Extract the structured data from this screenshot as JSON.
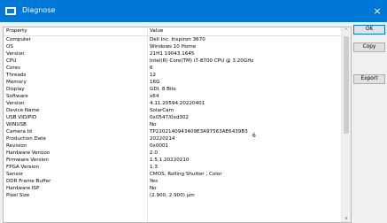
{
  "window": {
    "title": "Diagnose",
    "close_glyph": "×"
  },
  "table": {
    "columns": {
      "property": "Property",
      "value": "Value"
    },
    "rows": [
      {
        "property": "Computer",
        "value": "Dell Inc. Inspiron 3670"
      },
      {
        "property": "OS",
        "value": "Windows 10 Home"
      },
      {
        "property": "Version",
        "value": "21H1 19043.1645"
      },
      {
        "property": "CPU",
        "value": "Intel(R) Core(TM) i7-8700 CPU @ 3.20GHz"
      },
      {
        "property": "Cores",
        "value": "6"
      },
      {
        "property": "Threads",
        "value": "12"
      },
      {
        "property": "Memory",
        "value": "16G"
      },
      {
        "property": "Display",
        "value": "GDI, 8 Bits"
      },
      {
        "property": "Software",
        "value": "x64"
      },
      {
        "property": "Version",
        "value": "4.11.20594.20220401"
      },
      {
        "property": "Device Name",
        "value": "SolarCam"
      },
      {
        "property": "USB VID/PID",
        "value": "0x0547/0xd302"
      },
      {
        "property": "WINUSB",
        "value": "No"
      },
      {
        "property": "Camera Id",
        "value": "TP2202140943409E3A97563AE6439B3"
      },
      {
        "property": "Production Date",
        "value": "20220214"
      },
      {
        "property": "Revision",
        "value": "0x0001"
      },
      {
        "property": "Hardware Version",
        "value": "2.0"
      },
      {
        "property": "Firmware Version",
        "value": "1.5.1.20220210"
      },
      {
        "property": "FPGA Version",
        "value": "1.3"
      },
      {
        "property": "Sensor",
        "value": "CMOS, Rolling Shutter , Color"
      },
      {
        "property": "DDR Frame Buffer",
        "value": "Yes"
      },
      {
        "property": "Hardware ISP",
        "value": "No"
      },
      {
        "property": "Pixel Size",
        "value": "(2.900, 2.900) µm"
      }
    ],
    "stray_text": "6"
  },
  "buttons": {
    "ok": "OK",
    "copy": "Copy",
    "export": "Export"
  },
  "scrollbar": {
    "up_glyph": "^",
    "down_glyph": "v"
  },
  "colors": {
    "titlebar": "#0078d7",
    "window_bg": "#f0f0f0"
  }
}
